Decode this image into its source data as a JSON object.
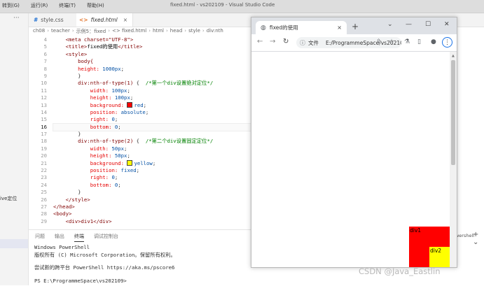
{
  "titlebar": {
    "menu": [
      "转到(G)",
      "运行(R)",
      "终端(T)",
      "帮助(H)"
    ],
    "title": "fixed.html - vs202109 - Visual Studio Code"
  },
  "activity": {
    "dots": "···",
    "side_label": "ive定位"
  },
  "tabs": [
    {
      "icon": "#",
      "label": "style.css",
      "close": ""
    },
    {
      "icon": "<>",
      "label": "fixed.html",
      "close": "×"
    }
  ],
  "breadcrumb": [
    "ch08",
    "teacher",
    "示例5：fixed",
    "<> fixed.html",
    "html",
    "head",
    "style",
    "div:nth"
  ],
  "editor": {
    "line_numbers": [
      "4",
      "5",
      "6",
      "7",
      "8",
      "9",
      "10",
      "11",
      "12",
      "13",
      "14",
      "15",
      "16",
      "17",
      "18",
      "19",
      "20",
      "21",
      "22",
      "23",
      "24",
      "25",
      "26",
      "27",
      "28",
      "29"
    ],
    "current_line": "16"
  },
  "code": {
    "l4": "    <meta charset=\"UTF-8\">",
    "l5_open": "    <title>",
    "l5_text": "fixed的使用",
    "l5_close": "</title>",
    "l6": "    <style>",
    "l7": "        body{",
    "l8_prop": "        height:",
    "l8_val": " 1000px",
    "l9": "        }",
    "l10_sel": "        div:nth-of-type(1)",
    "l10_pun": " {",
    "l10_cmt": "  /*第一个div设置绝对定位*/",
    "l11_prop": "            width:",
    "l11_val": " 100px",
    "l12_prop": "            height:",
    "l12_val": " 100px",
    "l13_prop": "            background:",
    "l13_val": "red",
    "l14_prop": "            position:",
    "l14_val": " absolute",
    "l15_prop": "            right:",
    "l15_val": " 0",
    "l16_prop": "            bottom:",
    "l16_val": " 0",
    "l17": "        }",
    "l18_sel": "        div:nth-of-type(2)",
    "l18_pun": " {",
    "l18_cmt": "  /*第二个div设置固定定位*/",
    "l19_prop": "            width:",
    "l19_val": " 50px",
    "l20_prop": "            height:",
    "l20_val": " 50px",
    "l21_prop": "            background:",
    "l21_val": "yellow",
    "l22_prop": "            position:",
    "l22_val": " fixed",
    "l23_prop": "            right:",
    "l23_val": " 0",
    "l24_prop": "            bottom:",
    "l24_val": " 0",
    "l25": "        }",
    "l26": "    </style>",
    "l27": "</head>",
    "l28": "<body>",
    "l29": "    <div>div1</div>",
    "semi": ";"
  },
  "panel": {
    "tabs": [
      "问题",
      "输出",
      "终端",
      "调试控制台"
    ],
    "right_label": "owershell",
    "plus": "+ ⌄",
    "terminal": [
      "Windows PowerShell",
      "版权所有 (C) Microsoft Corporation。保留所有权利。",
      "尝试新的跨平台 PowerShell https://aka.ms/pscore6",
      "PS E:\\ProgrammeSpace\\vs202109>"
    ]
  },
  "browser": {
    "tab_title": "fixed的使用",
    "tab_close": "×",
    "new_tab": "+",
    "win_controls": [
      "⌄",
      "—",
      "☐",
      "✕"
    ],
    "nav": [
      "←",
      "→",
      "↻"
    ],
    "address_prefix": "文件",
    "address": "E:/ProgrammeSpace/vs202109/ch08/teacher/示例5：fixed/fixed.html",
    "tools": [
      "⇪",
      "☆",
      "⚗",
      "▯",
      "●"
    ],
    "menu": "⋮",
    "div1_text": "div1",
    "div2_text": "div2"
  },
  "colors": {
    "div1": "#ff0000",
    "div2": "#ffff00",
    "accent": "#1a73e8"
  },
  "watermark": "CSDN @Java_Eastlin"
}
